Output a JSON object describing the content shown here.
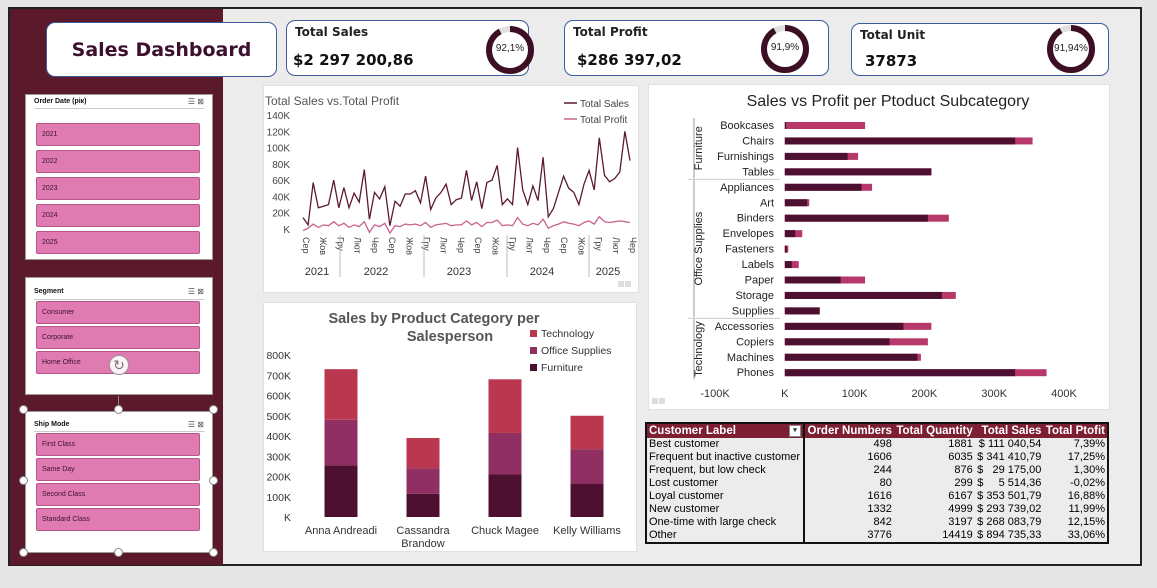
{
  "dashboard_title": "Sales Dashboard",
  "kpis": [
    {
      "label": "Total Sales",
      "value": "$2 297 200,86",
      "percent_label": "92,1%",
      "percent": 0.921
    },
    {
      "label": "Total Profit",
      "value": "$286 397,02",
      "percent_label": "91,9%",
      "percent": 0.919
    },
    {
      "label": "Total Unit",
      "value": "37873",
      "percent_label": "91,94%",
      "percent": 0.9194
    }
  ],
  "slicers": {
    "order_date": {
      "title": "Order Date (рік)",
      "items": [
        "2021",
        "2022",
        "2023",
        "2024",
        "2025"
      ]
    },
    "segment": {
      "title": "Segment",
      "items": [
        "Consumer",
        "Corporate",
        "Home Office"
      ]
    },
    "ship_mode": {
      "title": "Ship Mode",
      "items": [
        "First Class",
        "Same Day",
        "Second Class",
        "Standard Class"
      ]
    }
  },
  "colors": {
    "sidebar": "#5b1a2c",
    "slicer_item": "#df7bb0",
    "dark": "#4d1030",
    "mid": "#8f2f62",
    "light": "#b9384f",
    "table_header": "#7c1f33"
  },
  "icons": {
    "filter": "filter-icon",
    "clear": "clear-filter-icon",
    "rotate": "rotate-icon"
  },
  "chart_data": [
    {
      "type": "line",
      "title": "Total Sales vs.Total Profit",
      "y_ticks": [
        "140K",
        "120K",
        "100K",
        "80K",
        "60K",
        "40K",
        "20K",
        "K"
      ],
      "ylim": [
        0,
        140000
      ],
      "month_labels": [
        "Сер",
        "Жов",
        "Гру",
        "Лют",
        "Чер",
        "Сер",
        "Жов",
        "Гру",
        "Лют",
        "Чер",
        "Сер",
        "Жов",
        "Гру",
        "Лют",
        "Чер",
        "Сер",
        "Жов",
        "Гру",
        "Лют",
        "Чер"
      ],
      "year_labels": [
        "2021",
        "2022",
        "2023",
        "2024",
        "2025"
      ],
      "legend_position": "top-right",
      "series": [
        {
          "name": "Total Sales",
          "color": "#5b1a2c",
          "values": [
            14000,
            5000,
            57000,
            26000,
            28000,
            30000,
            60000,
            26000,
            51000,
            26000,
            44000,
            33000,
            73000,
            12000,
            45000,
            37000,
            52000,
            4000,
            34000,
            28000,
            43000,
            43000,
            47000,
            32000,
            65000,
            24000,
            38000,
            45000,
            55000,
            30000,
            36000,
            38000,
            72000,
            35000,
            58000,
            25000,
            57000,
            60000,
            78000,
            30000,
            37000,
            30000,
            100000,
            48000,
            30000,
            53000,
            35000,
            88000,
            15000,
            25000,
            45000,
            65000,
            50000,
            45000,
            30000,
            55000,
            72000,
            48000,
            112000,
            66000,
            58000,
            62000,
            70000,
            120000,
            84000
          ]
        },
        {
          "name": "Total Profit",
          "color": "#c8628f",
          "values": [
            -2000,
            1000,
            6000,
            2000,
            5000,
            4000,
            9000,
            4000,
            7000,
            2000,
            5000,
            3000,
            9000,
            -4000,
            5000,
            3000,
            7000,
            -5000,
            4000,
            3000,
            6000,
            5000,
            6000,
            4000,
            8000,
            2000,
            5000,
            6000,
            7000,
            4000,
            5000,
            5000,
            10000,
            5000,
            8000,
            3000,
            8000,
            8000,
            11000,
            4000,
            5000,
            4000,
            14000,
            6000,
            4000,
            7000,
            5000,
            12000,
            1000,
            4000,
            6000,
            9000,
            7000,
            6000,
            4000,
            8000,
            10000,
            6000,
            15000,
            9000,
            8000,
            9000,
            10000,
            9000,
            8000
          ]
        }
      ]
    },
    {
      "type": "bar",
      "stacked": true,
      "title": "Sales by Product Category per Salesperson",
      "categories": [
        "Anna Andreadi",
        "Cassandra Brandow",
        "Chuck Magee",
        "Kelly Williams"
      ],
      "y_ticks": [
        "800K",
        "700K",
        "600K",
        "500K",
        "400K",
        "300K",
        "200K",
        "100K",
        "K"
      ],
      "ylim": [
        0,
        800000
      ],
      "legend_position": "top-right",
      "series": [
        {
          "name": "Furniture",
          "color": "#4d1030",
          "values": [
            255000,
            115000,
            210000,
            165000
          ]
        },
        {
          "name": "Office Supplies",
          "color": "#8f2f62",
          "values": [
            225000,
            125000,
            205000,
            170000
          ]
        },
        {
          "name": "Technology",
          "color": "#b9384f",
          "values": [
            250000,
            150000,
            265000,
            165000
          ]
        }
      ]
    },
    {
      "type": "bar",
      "orientation": "horizontal",
      "title": "Sales vs Profit per Ptoduct Subcategory",
      "x_ticks": [
        "-100K",
        "K",
        "100K",
        "200K",
        "300K",
        "400K"
      ],
      "xlim": [
        -100000,
        400000
      ],
      "groups": [
        {
          "name": "Furniture",
          "items": [
            "Bookcases",
            "Chairs",
            "Furnishings",
            "Tables"
          ]
        },
        {
          "name": "Office Supplies",
          "items": [
            "Appliances",
            "Art",
            "Binders",
            "Envelopes",
            "Fasteners",
            "Labels",
            "Paper",
            "Storage",
            "Supplies"
          ]
        },
        {
          "name": "Technology",
          "items": [
            "Accessories",
            "Copiers",
            "Machines",
            "Phones"
          ]
        }
      ],
      "series": [
        {
          "name": "Sales",
          "color": "#b9386a",
          "values": [
            115000,
            355000,
            105000,
            210000,
            125000,
            35000,
            235000,
            25000,
            5000,
            20000,
            115000,
            245000,
            50000,
            210000,
            205000,
            195000,
            375000
          ]
        },
        {
          "name": "Profit",
          "color": "#4d1030",
          "values": [
            2000,
            330000,
            90000,
            210000,
            110000,
            32000,
            205000,
            15000,
            3000,
            10000,
            80000,
            225000,
            50000,
            170000,
            150000,
            190000,
            330000
          ]
        }
      ]
    },
    {
      "type": "table",
      "columns": [
        "Customer Label",
        "Order Numbers",
        "Total Quantity",
        "Total Sales",
        "Total Ptofit"
      ],
      "rows": [
        [
          "Best customer",
          "498",
          "1881",
          "$ 111 040,54",
          "7,39%"
        ],
        [
          "Frequent but inactive customer",
          "1606",
          "6035",
          "$ 341 410,79",
          "17,25%"
        ],
        [
          "Frequent, but low check",
          "244",
          "876",
          "$   29 175,00",
          "1,30%"
        ],
        [
          "Lost customer",
          "80",
          "299",
          "$     5 514,36",
          "-0,02%"
        ],
        [
          "Loyal customer",
          "1616",
          "6167",
          "$ 353 501,79",
          "16,88%"
        ],
        [
          "New customer",
          "1332",
          "4999",
          "$ 293 739,02",
          "11,99%"
        ],
        [
          "One-time with large check",
          "842",
          "3197",
          "$ 268 083,79",
          "12,15%"
        ],
        [
          "Other",
          "3776",
          "14419",
          "$ 894 735,33",
          "33,06%"
        ]
      ]
    }
  ]
}
